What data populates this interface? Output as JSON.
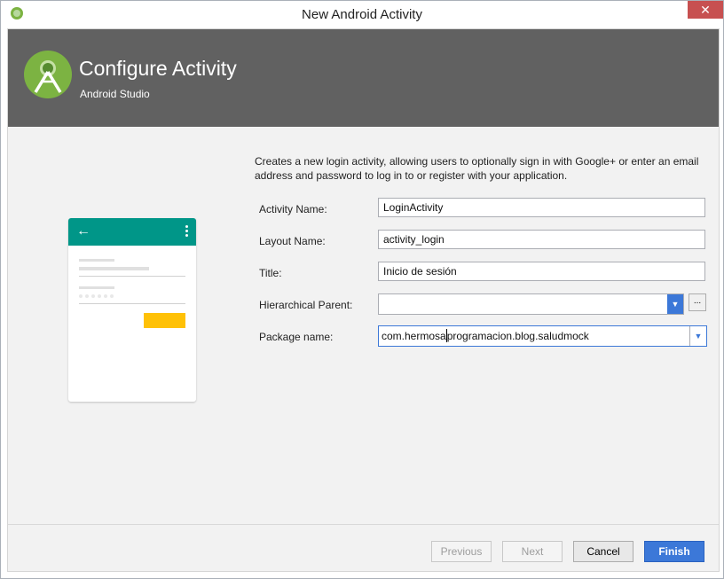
{
  "window": {
    "title": "New Android Activity",
    "close_glyph": "✕"
  },
  "header": {
    "title": "Configure Activity",
    "subtitle": "Android Studio",
    "logo_icon": "android-studio-logo"
  },
  "description": "Creates a new login activity, allowing users to optionally sign in with Google+ or enter an email address and password to log in to or register with your application.",
  "preview": {
    "back_glyph": "←",
    "accent_colors": {
      "toolbar": "#009688",
      "button": "#ffc107"
    }
  },
  "form": {
    "activity_name_label": "Activity Name:",
    "activity_name_value": "LoginActivity",
    "layout_name_label": "Layout Name:",
    "layout_name_value": "activity_login",
    "title_label": "Title:",
    "title_value": "Inicio de sesión",
    "hierarchical_parent_label": "Hierarchical Parent:",
    "hierarchical_parent_value": "",
    "ellipsis_label": "...",
    "package_name_label": "Package name:",
    "package_name_value_before_cursor": "com.hermosa",
    "package_name_value_after_cursor": "programacion.blog.saludmock",
    "dropdown_glyph": "▼"
  },
  "buttons": {
    "previous": "Previous",
    "next": "Next",
    "cancel": "Cancel",
    "finish": "Finish"
  },
  "colors": {
    "header_bg": "#616161",
    "primary": "#3c78d8",
    "close": "#c75050"
  }
}
